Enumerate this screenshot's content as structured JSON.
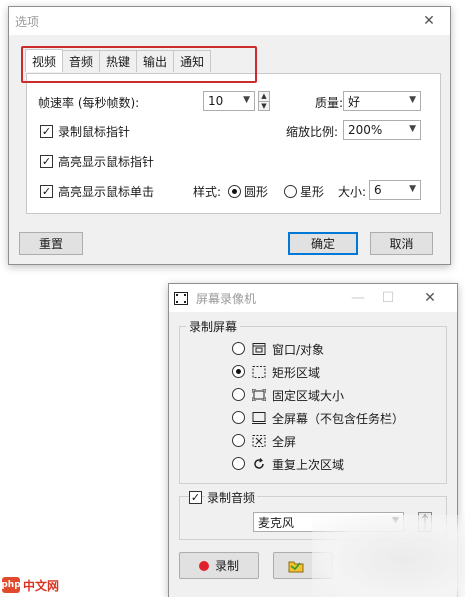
{
  "options": {
    "title": "选项",
    "tabs": [
      "视频",
      "音频",
      "热键",
      "输出",
      "通知"
    ],
    "active_tab": "视频",
    "framerate": {
      "label": "帧速率 (每秒帧数):",
      "value": "10"
    },
    "quality": {
      "label": "质量:",
      "value": "好"
    },
    "record_cursor": {
      "label": "录制鼠标指针",
      "checked": true
    },
    "scale": {
      "label": "缩放比例:",
      "value": "200%"
    },
    "highlight_cursor": {
      "label": "高亮显示鼠标指针",
      "checked": true
    },
    "highlight_click": {
      "label": "高亮显示鼠标单击",
      "checked": true
    },
    "style": {
      "label": "样式:",
      "circle": "圆形",
      "star": "星形",
      "selected": "圆形"
    },
    "size": {
      "label": "大小:",
      "value": "6"
    },
    "buttons": {
      "reset": "重置",
      "ok": "确定",
      "cancel": "取消"
    },
    "close_glyph": "✕"
  },
  "recorder": {
    "title": "屏幕录像机",
    "group_title": "录制屏幕",
    "modes": [
      {
        "label": "窗口/对象",
        "icon": "window-icon",
        "selected": false
      },
      {
        "label": "矩形区域",
        "icon": "rectangle-region-icon",
        "selected": true
      },
      {
        "label": "固定区域大小",
        "icon": "fixed-region-icon",
        "selected": false
      },
      {
        "label": "全屏幕（不包含任务栏）",
        "icon": "fullscreen-no-taskbar-icon",
        "selected": false
      },
      {
        "label": "全屏",
        "icon": "fullscreen-icon",
        "selected": false
      },
      {
        "label": "重复上次区域",
        "icon": "repeat-icon",
        "selected": false
      }
    ],
    "audio": {
      "label": "录制音频",
      "checked": true,
      "device": "麦克风"
    },
    "record_button": "录制",
    "window_controls": {
      "minimize": "—",
      "maximize": "☐",
      "close": "✕"
    }
  },
  "watermark": {
    "logo": "php",
    "text": "中文网"
  },
  "colors": {
    "highlight_border": "#cc2b2b",
    "default_button": "#0078d7",
    "record_dot": "#e0202a"
  }
}
